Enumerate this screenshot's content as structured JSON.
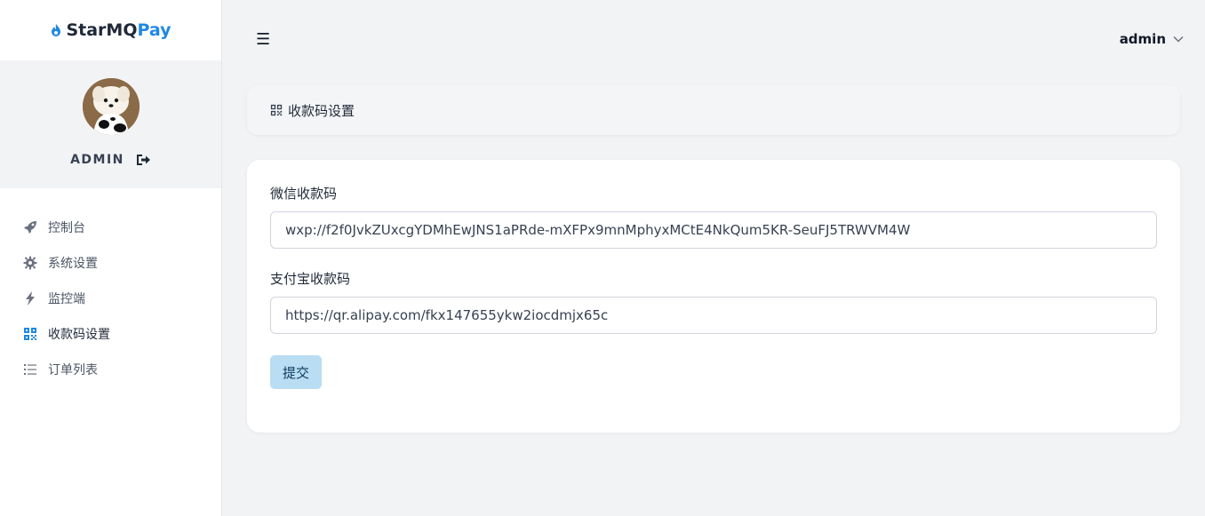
{
  "brand": {
    "name_prefix": "StarMQ",
    "name_suffix": "Pay",
    "accent": "#1e88e5"
  },
  "profile": {
    "name": "ADMIN",
    "avatar_icon": "dog-photo-avatar",
    "logout_icon": "logout-icon"
  },
  "nav": {
    "items": [
      {
        "label": "控制台",
        "icon": "rocket-icon",
        "active": false
      },
      {
        "label": "系统设置",
        "icon": "gear-icon",
        "active": false
      },
      {
        "label": "监控端",
        "icon": "bolt-icon",
        "active": false
      },
      {
        "label": "收款码设置",
        "icon": "qrcode-icon",
        "active": true
      },
      {
        "label": "订单列表",
        "icon": "list-icon",
        "active": false
      }
    ]
  },
  "topbar": {
    "menu_icon": "☰",
    "user": "admin"
  },
  "breadcrumb": {
    "title": "收款码设置"
  },
  "form": {
    "wechat_label": "微信收款码",
    "wechat_value": "wxp://f2f0JvkZUxcgYDMhEwJNS1aPRde-mXFPx9mnMphyxMCtE4NkQum5KR-SeuFJ5TRWVM4W",
    "alipay_label": "支付宝收款码",
    "alipay_value": "https://qr.alipay.com/fkx147655ykw2iocdmjx65c",
    "submit_label": "提交"
  }
}
